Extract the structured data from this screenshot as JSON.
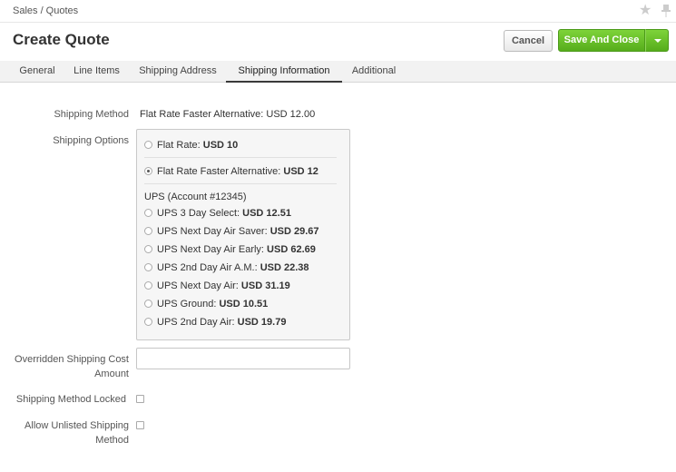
{
  "breadcrumb": "Sales / Quotes",
  "page_title": "Create Quote",
  "buttons": {
    "cancel": "Cancel",
    "save_and_close": "Save And Close"
  },
  "tabs": [
    "General",
    "Line Items",
    "Shipping Address",
    "Shipping Information",
    "Additional"
  ],
  "active_tab": "Shipping Information",
  "form": {
    "shipping_method_label": "Shipping Method",
    "shipping_method_value": "Flat Rate Faster Alternative: USD 12.00",
    "shipping_options_label": "Shipping Options",
    "options": [
      {
        "label": "Flat Rate: ",
        "price": "USD 10",
        "checked": false
      },
      {
        "label": "Flat Rate Faster Alternative: ",
        "price": "USD 12",
        "checked": true
      }
    ],
    "ups_group_title": "UPS (Account #12345)",
    "ups_options": [
      {
        "label": "UPS 3 Day Select: ",
        "price": "USD 12.51"
      },
      {
        "label": "UPS Next Day Air Saver: ",
        "price": "USD 29.67"
      },
      {
        "label": "UPS Next Day Air Early: ",
        "price": "USD 62.69"
      },
      {
        "label": "UPS 2nd Day Air A.M.: ",
        "price": "USD 22.38"
      },
      {
        "label": "UPS Next Day Air: ",
        "price": "USD 31.19"
      },
      {
        "label": "UPS Ground: ",
        "price": "USD 10.51"
      },
      {
        "label": "UPS 2nd Day Air: ",
        "price": "USD 19.79"
      }
    ],
    "overridden_cost_label_1": "Overridden Shipping Cost",
    "overridden_cost_label_2": "Amount",
    "overridden_cost_value": "",
    "method_locked_label": "Shipping Method Locked",
    "method_locked_checked": false,
    "allow_unlisted_label_1": "Allow Unlisted Shipping",
    "allow_unlisted_label_2": "Method",
    "allow_unlisted_checked": false
  },
  "icons": {
    "favorite": "star-icon",
    "pin": "pin-icon"
  },
  "colors": {
    "primary_button": "#5cb21f"
  }
}
